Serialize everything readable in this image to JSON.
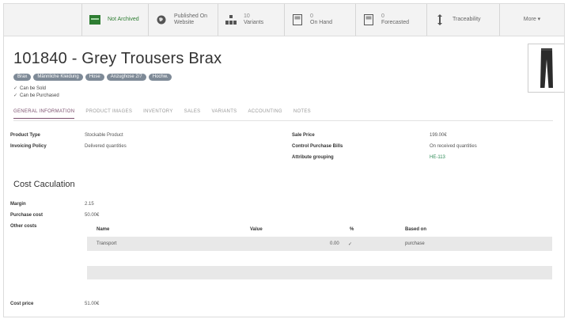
{
  "smart_buttons": [
    {
      "name": "not-archived-button",
      "icon": "archive-icon",
      "number": "",
      "label": "Not Archived",
      "active": true,
      "width": 84
    },
    {
      "name": "published-button",
      "icon": "globe-icon",
      "number": "",
      "label": "Published On Website",
      "active": false,
      "width": 88
    },
    {
      "name": "variants-button",
      "icon": "variants-icon",
      "number": "10",
      "label": "Variants",
      "active": false,
      "width": 84
    },
    {
      "name": "on-hand-button",
      "icon": "stock-icon",
      "number": "0",
      "label": "On Hand",
      "active": false,
      "width": 90
    },
    {
      "name": "forecasted-button",
      "icon": "forecast-icon",
      "number": "0",
      "label": "Forecasted",
      "active": false,
      "width": 90
    },
    {
      "name": "traceability-button",
      "icon": "traceability-icon",
      "number": "",
      "label": "Traceability",
      "active": false,
      "width": 92
    },
    {
      "name": "more-button",
      "icon": "",
      "number": "",
      "label": "More ▾",
      "active": false,
      "width": 82
    }
  ],
  "product": {
    "title": "101840 - Grey Trousers Brax",
    "tags": [
      "Brax",
      "Männliche Kleidung",
      "Hose",
      "Anzughose 2/7",
      "Hochw."
    ],
    "can_be_sold": "Can be Sold",
    "can_be_purchased": "Can be Purchased",
    "image_icon": "trousers-icon"
  },
  "tabs": [
    "GENERAL INFORMATION",
    "PRODUCT IMAGES",
    "INVENTORY",
    "SALES",
    "VARIANTS",
    "ACCOUNTING",
    "NOTES"
  ],
  "general": {
    "left": [
      {
        "label": "Product Type",
        "value": "Stockable Product"
      },
      {
        "label": "Invoicing Policy",
        "value": "Delivered quantities"
      }
    ],
    "right": [
      {
        "label": "Sale Price",
        "value": "199.00€",
        "link": false
      },
      {
        "label": "Control Purchase Bills",
        "value": "On received quantities",
        "link": false
      },
      {
        "label": "Attribute grouping",
        "value": "HE-113",
        "link": true
      }
    ]
  },
  "cost": {
    "section_title": "Cost Caculation",
    "margin_label": "Margin",
    "margin_value": "2.15",
    "purchase_cost_label": "Purchase cost",
    "purchase_cost_value": "50.00€",
    "other_costs_label": "Other costs",
    "columns": [
      "Name",
      "Value",
      "%",
      "Based on"
    ],
    "rows": [
      {
        "name": "Transport",
        "value": "",
        "percent": "0.00",
        "percent_mark": "✓",
        "based_on": "purchase"
      }
    ],
    "cost_price_label": "Cost price",
    "cost_price_value": "51.00€"
  }
}
